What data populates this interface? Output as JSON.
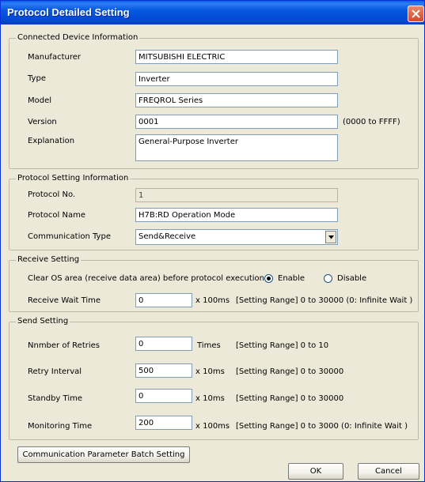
{
  "window": {
    "title": "Protocol Detailed Setting"
  },
  "connected": {
    "group_title": "Connected Device Information",
    "manufacturer_label": "Manufacturer",
    "manufacturer": "MITSUBISHI ELECTRIC",
    "type_label": "Type",
    "type": "Inverter",
    "model_label": "Model",
    "model": "FREQROL Series",
    "version_label": "Version",
    "version": "0001",
    "version_range": "(0000 to FFFF)",
    "explanation_label": "Explanation",
    "explanation": "General-Purpose Inverter"
  },
  "protocol": {
    "group_title": "Protocol Setting Information",
    "no_label": "Protocol No.",
    "no": "1",
    "name_label": "Protocol Name",
    "name": "H7B:RD Operation Mode",
    "comm_label": "Communication Type",
    "comm": "Send&Receive"
  },
  "receive": {
    "group_title": "Receive Setting",
    "clear_label": "Clear OS area (receive data area) before protocol execution",
    "enable_label": "Enable",
    "disable_label": "Disable",
    "selected": "Enable",
    "wait_label": "Receive Wait Time",
    "wait": "0",
    "wait_unit": "x 100ms",
    "wait_range": "[Setting Range] 0 to 30000 (0: Infinite Wait )"
  },
  "send": {
    "group_title": "Send Setting",
    "retries_label": "Nnmber of Retries",
    "retries": "0",
    "retries_unit": "Times",
    "retries_range": "[Setting Range] 0 to 10",
    "interval_label": "Retry Interval",
    "interval": "500",
    "interval_unit": "x 10ms",
    "interval_range": "[Setting Range] 0 to 30000",
    "standby_label": "Standby Time",
    "standby": "0",
    "standby_unit": "x 10ms",
    "standby_range": "[Setting Range] 0 to 30000",
    "monitor_label": "Monitoring Time",
    "monitor": "200",
    "monitor_unit": "x 100ms",
    "monitor_range": "[Setting Range] 0 to 3000 (0: Infinite Wait )"
  },
  "buttons": {
    "batch": "Communication Parameter Batch Setting",
    "ok": "OK",
    "cancel": "Cancel"
  },
  "icons": {
    "close": "close-icon",
    "dropdown": "chevron-down-icon"
  }
}
